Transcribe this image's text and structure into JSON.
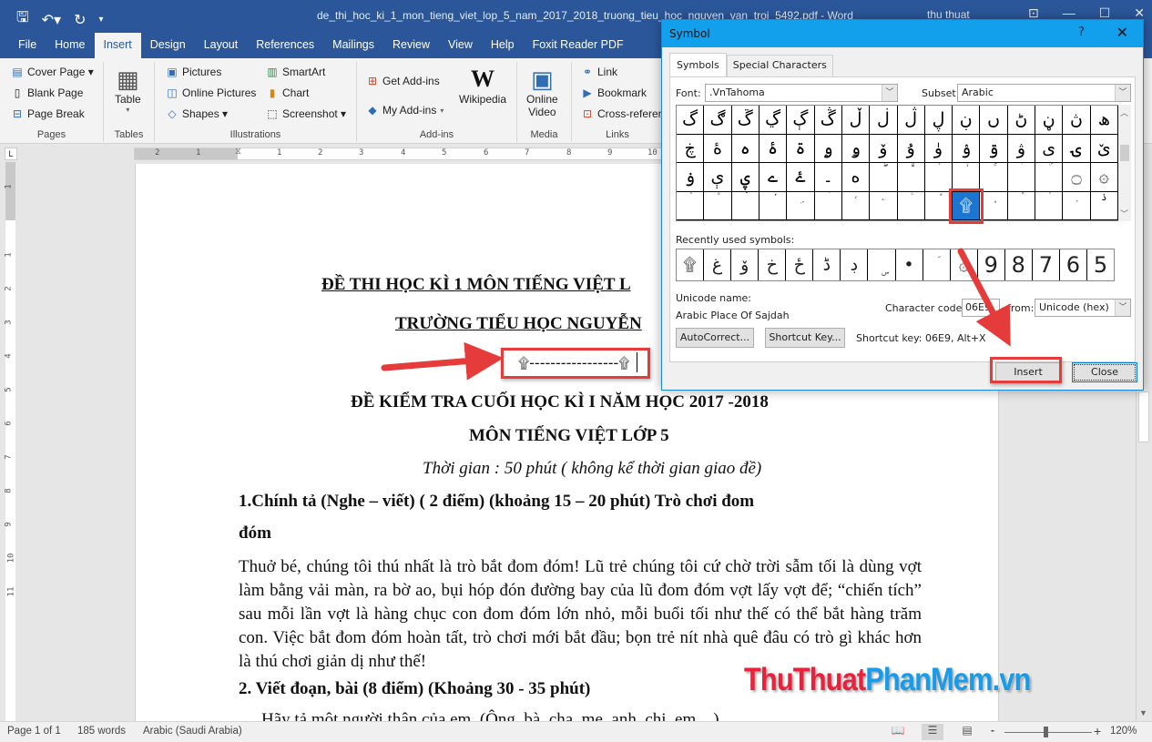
{
  "titlebar": {
    "qat_icons": [
      "save-icon",
      "undo-icon",
      "redo-icon",
      "customize-icon"
    ],
    "qat_glyphs": [
      "🖫",
      "↶▾",
      "↻",
      "▾"
    ],
    "document_title": "de_thi_hoc_ki_1_mon_tieng_viet_lop_5_nam_2017_2018_truong_tieu_hoc_nguyen_van_troi_5492.pdf - Word",
    "user_name": "thu thuat",
    "controls": [
      "⊡",
      "—",
      "☐",
      "✕"
    ]
  },
  "ribbon_tabs": [
    "File",
    "Home",
    "Insert",
    "Design",
    "Layout",
    "References",
    "Mailings",
    "Review",
    "View",
    "Help",
    "Foxit Reader PDF"
  ],
  "active_tab": "Insert",
  "ribbon": {
    "pages": {
      "label": "Pages",
      "items": [
        "Cover Page ▾",
        "Blank Page",
        "Page Break"
      ]
    },
    "tables": {
      "label": "Tables",
      "items": [
        "Table"
      ]
    },
    "illustrations": {
      "label": "Illustrations",
      "items": [
        "Pictures",
        "Online Pictures",
        "Shapes ▾",
        "SmartArt",
        "Chart",
        "Screenshot ▾"
      ]
    },
    "addins": {
      "label": "Add-ins",
      "items": [
        "Get Add-ins",
        "My Add-ins",
        "Wikipedia"
      ]
    },
    "media": {
      "label": "Media",
      "items": [
        "Online",
        "Video"
      ]
    },
    "links": {
      "label": "Links",
      "items": [
        "Link",
        "Bookmark",
        "Cross-referen"
      ]
    }
  },
  "ruler": {
    "h_labels": [
      "2",
      "1",
      "1",
      "2",
      "3",
      "4",
      "5",
      "6",
      "7",
      "8",
      "9",
      "10"
    ],
    "v_labels": [
      "1",
      "1",
      "2",
      "3",
      "4",
      "5",
      "6",
      "7",
      "8",
      "9",
      "10",
      "11"
    ]
  },
  "document": {
    "heading1": "ĐỀ THI HỌC KÌ 1 MÔN TIẾNG VIỆT L",
    "heading2": "TRƯỜNG TIỂU HỌC NGUYỄN",
    "symbol_line": "۩-----------------۩",
    "heading3": "ĐỀ KIỂM TRA CUỐI HỌC KÌ I NĂM HỌC 2017 -2018",
    "heading4": "MÔN TIẾNG VIỆT LỚP 5",
    "time_note": "Thời gian : 50 phút ( không kể thời gian giao đề)",
    "section1_title": "1.Chính tả (Nghe – viết) ( 2 điểm) (khoảng 15 – 20 phút) Trò chơi đom",
    "section1_title_cont": "đóm",
    "paragraph": "Thuở bé, chúng tôi thú nhất là trò bắt đom đóm! Lũ trẻ chúng tôi cứ chờ trời sẫm tối là dùng vợt làm bằng vải màn, ra bờ ao, bụi hóp đón đường bay của lũ đom đóm vợt lấy vợt để; “chiến tích” sau mỗi lần vợt là hàng chục con đom đóm lớn nhỏ, mỗi buổi tối như thế có thể bắt hàng trăm con. Việc bắt đom đóm hoàn tất, trò chơi mới bắt đầu; bọn trẻ nít nhà quê đâu có trò gì khác hơn là thú chơi giản dị như thế!",
    "section2_title": "2. Viết đoạn, bài (8 điểm) (Khoảng 30 - 35 phút)",
    "section2_line": "Hãy tả một người thân của em. (Ông, bà, cha, mẹ, anh, chị, em,...)"
  },
  "watermark": {
    "part1": "ThuThuat",
    "part2": "PhanMem",
    "part3": ".vn"
  },
  "statusbar": {
    "page": "Page 1 of 1",
    "words": "185 words",
    "language": "Arabic (Saudi Arabia)",
    "zoom_minus": "-",
    "zoom_plus": "+",
    "zoom_level": "120%",
    "zoom_percent": 120
  },
  "symbol_dialog": {
    "title": "Symbol",
    "help": "?",
    "close_x": "✕",
    "tabs": [
      "Symbols",
      "Special Characters"
    ],
    "font_label": "Font:",
    "font_value": ".VnTahoma",
    "subset_label": "Subset:",
    "subset_value": "Arabic",
    "grid": [
      [
        "گ",
        "ڰ",
        "ڱ",
        "ڲ",
        "ڳ",
        "ڴ",
        "ڵ",
        "ڶ",
        "ڷ",
        "ڸ",
        "ڹ",
        "ں",
        "ڻ",
        "ڼ",
        "ڽ",
        "ھ"
      ],
      [
        "ڿ",
        "ۀ",
        "ہ",
        "ۂ",
        "ۃ",
        "ۄ",
        "ۅ",
        "ۆ",
        "ۇ",
        "ۈ",
        "ۉ",
        "ۊ",
        "ۋ",
        "ی",
        "ۍ",
        "ێ"
      ],
      [
        "ۏ",
        "ې",
        "ۑ",
        "ے",
        "ۓ",
        "۔",
        "ە",
        "ۖ",
        "ۗ",
        "ۘ",
        "ۙ",
        "ۚ",
        "ۛ",
        "ۜ",
        "۝",
        "۞"
      ],
      [
        "۟",
        "۠",
        "ۡ",
        "ۢ",
        "ۣ",
        "ۤ",
        "ۥ",
        "ۦ",
        "ۧ",
        "ۨ",
        "۩",
        "۪",
        "۫",
        "۬",
        "ۭ",
        "ۮ"
      ]
    ],
    "selected_symbol": "۩",
    "recent_label": "Recently used symbols:",
    "recent": [
      "۩",
      "غ",
      "ۆ",
      "خ",
      "ځ",
      "ڈ",
      "ڊ",
      "ۣ",
      "•",
      "ؘ",
      "۞",
      "9",
      "8",
      "7",
      "6",
      "5"
    ],
    "unicode_name_label": "Unicode name:",
    "unicode_name": "Arabic Place Of Sajdah",
    "char_code_label": "Character code:",
    "char_code": "06E9",
    "from_label": "from:",
    "from_value": "Unicode (hex)",
    "autocorrect_button": "AutoCorrect...",
    "shortcut_button": "Shortcut Key...",
    "shortcut_text": "Shortcut key: 06E9, Alt+X",
    "insert_button": "Insert",
    "close_button": "Close"
  },
  "colors": {
    "word_blue": "#2b579a",
    "dialog_title": "#12a0ec",
    "highlight_red": "#e53b3b",
    "selection_blue": "#1b76d1"
  }
}
